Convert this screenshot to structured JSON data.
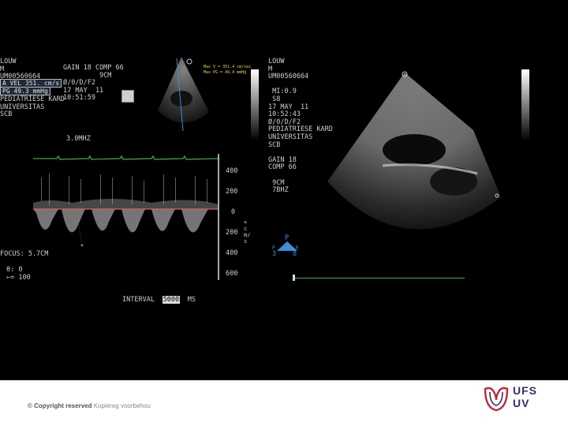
{
  "left_panel": {
    "patient_block": "LOUW\nM\nUM00560664\nMI:0.9\nS8\nPEDIATRIESE KARD\nUNIVERSITAS\nSCB",
    "settings_block": "GAIN 18 COMP 66\n         9CM\nØ/0/D/F2\n17 MAY  11\n10:51:59",
    "measure_line1": "A VEL 351. cm/s",
    "measure_line2": "PG 49.3 mmHg",
    "mini_readout": "Max V = 351.4 cm/sec\nMax PG = 49.4 mmHg",
    "freq": "3.0MHZ",
    "focus": "FOCUS: 5.7CM",
    "angle_block": "θ: 0\n←= 100",
    "interval_label": "INTERVAL",
    "interval_value": "5000",
    "interval_unit": "MS",
    "velocity_scale": [
      "400",
      "200",
      "0",
      "200",
      "400",
      "600"
    ],
    "vertical_side_label": "+ cm/s"
  },
  "right_panel": {
    "patient_block": "LOUW\nM\nUM00560664\n\n MI:0.9\n S8\n17 MAY  11\n10:52:43\nØ/0/D/F2\nPEDIATRIESE KARD\nUNIVERSITAS\nSCB\n\nGAIN 18\nCOMP 66\n\n 9CM\n 7BHZ",
    "orientation_left": "3",
    "orientation_right": "8",
    "orientation_top": "P",
    "orientation_r": "R"
  },
  "footer": {
    "copyright_bold": "© Copyright reserved",
    "copyright_rest": " Kopiereg voorbehou",
    "logo_line1": "UFS",
    "logo_line2": "UV"
  },
  "colors": {
    "background": "#000000",
    "footer_bg": "#ffffff",
    "baseline": "#e06060",
    "ecg": "#3fae4a",
    "cursor": "#3a8fd8",
    "logo_red": "#c0283a",
    "logo_purple": "#3a2a6e"
  }
}
